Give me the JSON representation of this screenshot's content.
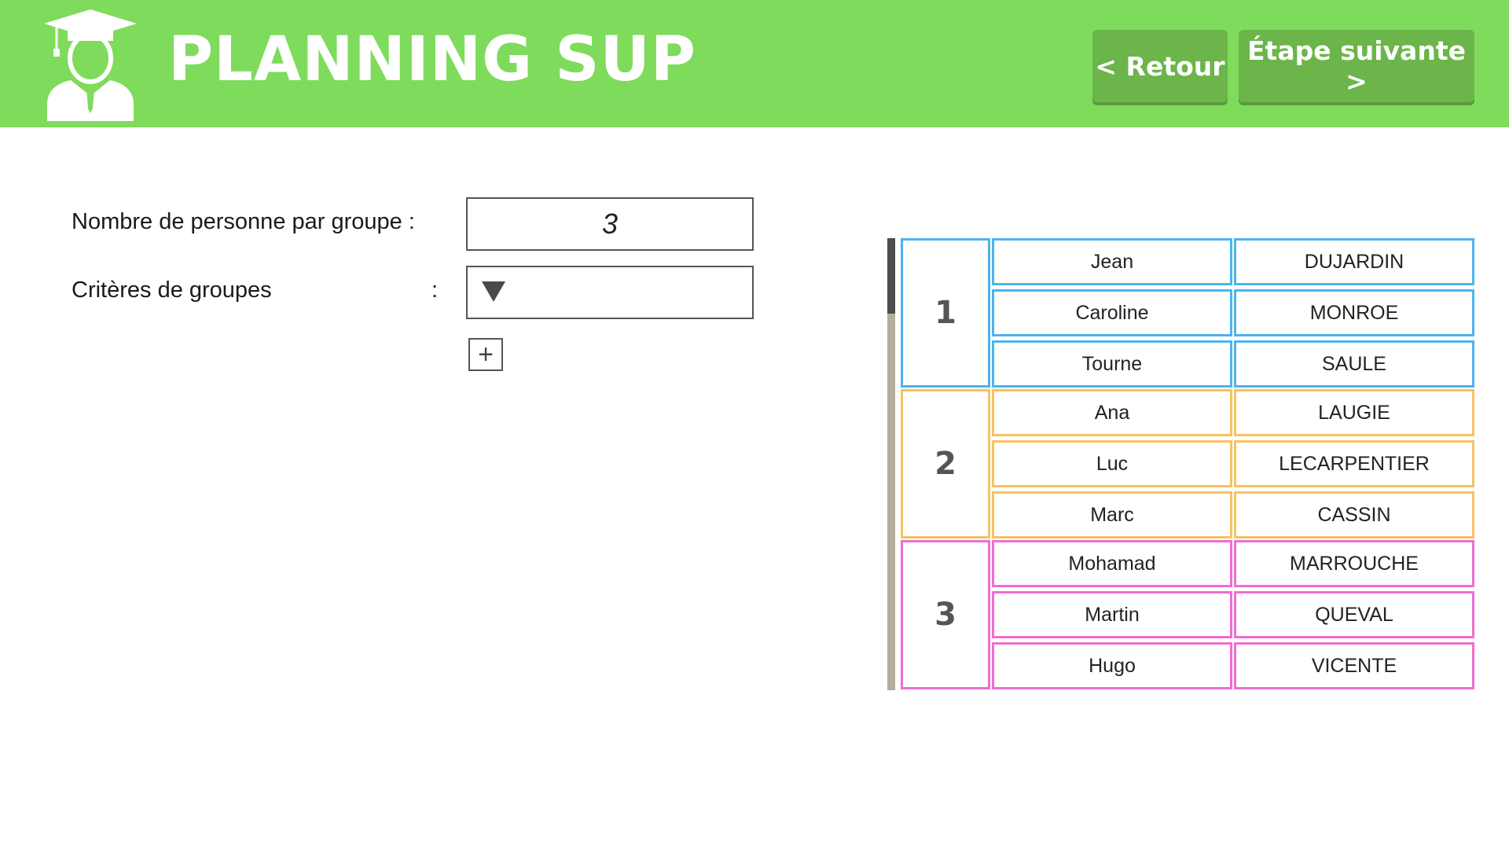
{
  "header": {
    "title": "PLANNING SUP",
    "back_label": "< Retour",
    "next_label": "Étape suivante >",
    "color": "#7fdb5c"
  },
  "form": {
    "group_size_label": "Nombre de personne par groupe :",
    "group_size_value": "3",
    "criteria_label": "Critères de groupes",
    "criteria_colon": ":",
    "criteria_value": "",
    "add_symbol": "+"
  },
  "groups": [
    {
      "number": "1",
      "color": "#4db3ee",
      "members": [
        {
          "first": "Jean",
          "last": "DUJARDIN"
        },
        {
          "first": "Caroline",
          "last": "MONROE"
        },
        {
          "first": "Tourne",
          "last": "SAULE"
        }
      ]
    },
    {
      "number": "2",
      "color": "#f7c261",
      "members": [
        {
          "first": "Ana",
          "last": "LAUGIE"
        },
        {
          "first": "Luc",
          "last": "LECARPENTIER"
        },
        {
          "first": "Marc",
          "last": "CASSIN"
        }
      ]
    },
    {
      "number": "3",
      "color": "#f06dd0",
      "members": [
        {
          "first": "Mohamad",
          "last": "MARROUCHE"
        },
        {
          "first": "Martin",
          "last": "QUEVAL"
        },
        {
          "first": "Hugo",
          "last": "VICENTE"
        }
      ]
    }
  ]
}
